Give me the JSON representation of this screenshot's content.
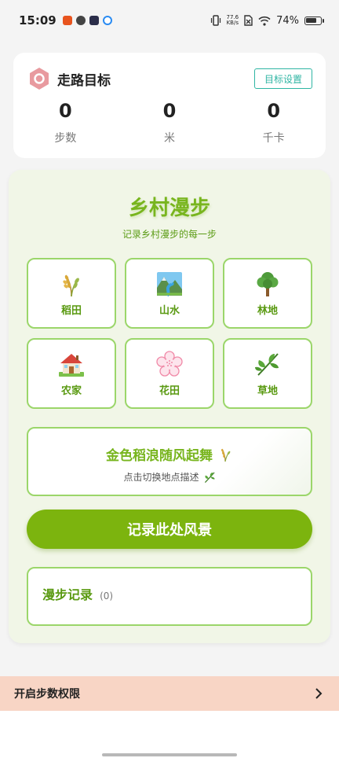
{
  "status_bar": {
    "time": "15:09",
    "net_speed_value": "77.6",
    "net_speed_unit": "KB/s",
    "battery": "74%"
  },
  "goal": {
    "title": "走路目标",
    "settings_button": "目标设置",
    "stats": [
      {
        "value": "0",
        "label": "步数"
      },
      {
        "value": "0",
        "label": "米"
      },
      {
        "value": "0",
        "label": "千卡"
      }
    ]
  },
  "walk": {
    "title": "乡村漫步",
    "subtitle": "记录乡村漫步的每一步",
    "places": [
      {
        "label": "稻田",
        "icon": "rice-icon"
      },
      {
        "label": "山水",
        "icon": "landscape-icon"
      },
      {
        "label": "林地",
        "icon": "tree-icon"
      },
      {
        "label": "农家",
        "icon": "house-icon"
      },
      {
        "label": "花田",
        "icon": "flower-icon"
      },
      {
        "label": "草地",
        "icon": "herb-icon"
      }
    ],
    "description": "金色稻浪随风起舞",
    "description_hint": "点击切换地点描述",
    "record_button": "记录此处风景",
    "record_title": "漫步记录",
    "record_count": "(0)"
  },
  "permission_bar": {
    "label": "开启步数权限"
  },
  "colors": {
    "accent_green": "#7cb40e",
    "border_green": "#9bd66a",
    "teal": "#2fb5a3",
    "permission_bg": "#f8d5c5"
  }
}
